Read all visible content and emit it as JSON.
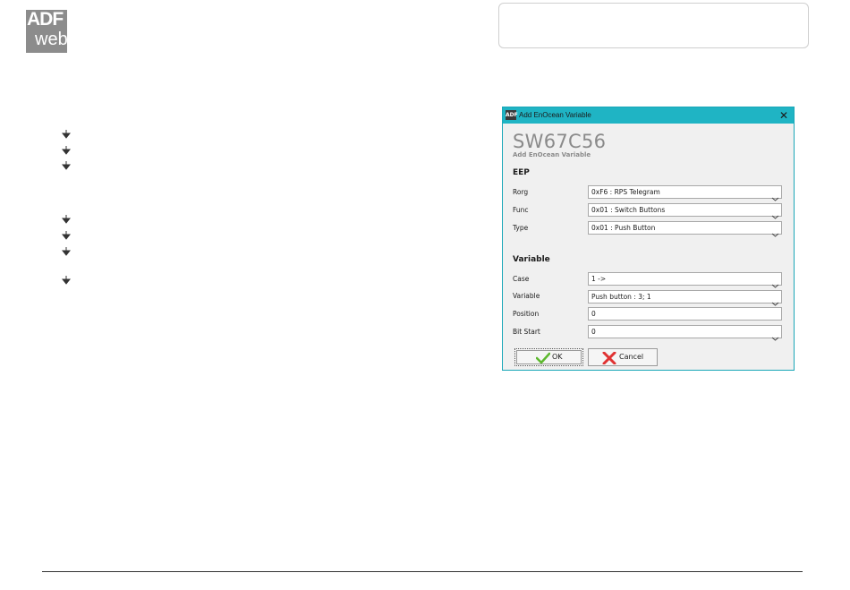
{
  "logo": {
    "line1": "ADF",
    "line2": "web"
  },
  "dialog": {
    "title": "Add EnOcean Variable",
    "app_icon_text": "ADF",
    "close_glyph": "✕",
    "heading": "SW67C56",
    "subheading": "Add EnOcean Variable",
    "eep_section": "EEP",
    "variable_section": "Variable",
    "fields": {
      "rorg": {
        "label": "Rorg",
        "value": "0xF6 : RPS Telegram"
      },
      "func": {
        "label": "Func",
        "value": "0x01 : Switch Buttons"
      },
      "type": {
        "label": "Type",
        "value": "0x01 : Push Button"
      },
      "case": {
        "label": "Case",
        "value": "1 ->"
      },
      "variable": {
        "label": "Variable",
        "value": "Push button : 3; 1"
      },
      "position": {
        "label": "Position",
        "value": "0"
      },
      "bit_start": {
        "label": "Bit Start",
        "value": "0"
      }
    },
    "ok_label": "OK",
    "cancel_label": "Cancel"
  },
  "colors": {
    "titlebar": "#1fb4c4",
    "logo_bg": "#8c8c8c",
    "ok_check": "#5cb82e",
    "cancel_x": "#e03232"
  },
  "icons": {
    "bullet": "bullet-arrow-icon",
    "dropdown": "chevron-down-icon",
    "ok": "check-icon",
    "cancel": "red-x-icon"
  }
}
